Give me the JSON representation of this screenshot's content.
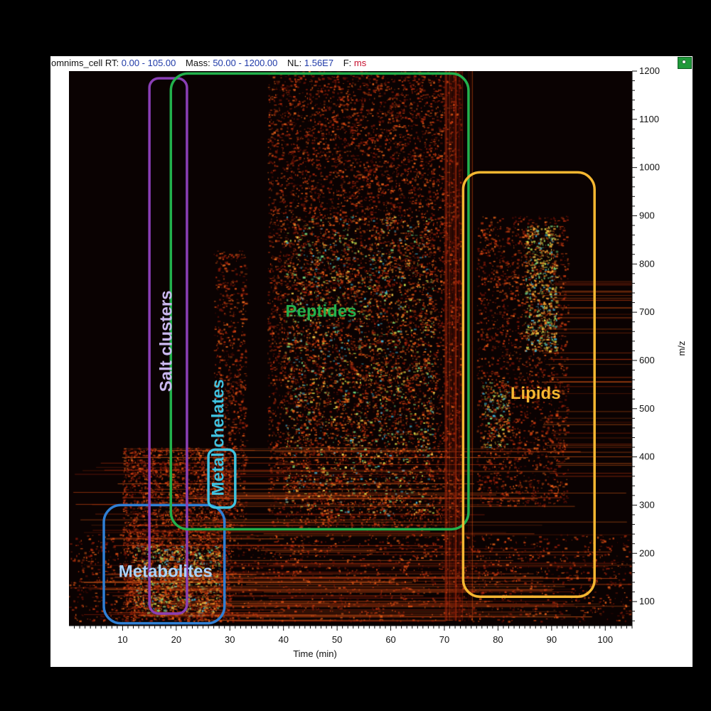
{
  "header": {
    "file_name": "omnims_cell",
    "rt_label": "RT:",
    "rt_range": "0.00 - 105.00",
    "mass_label": "Mass:",
    "mass_range": "50.00 - 1200.00",
    "nl_label": "NL:",
    "nl_value": "1.56E7",
    "f_label": "F:",
    "f_value": "ms"
  },
  "colors": {
    "header_value": "#1f3aa8",
    "header_filter": "#c8102e",
    "metabolites": "#2f7fd4",
    "salt_clusters": "#8a3fb6",
    "metal_chelates": "#3fc3e0",
    "peptides": "#22b14c",
    "lipids": "#f5b731"
  },
  "corner_icon": "settings-icon",
  "chart_data": {
    "type": "heatmap",
    "xlabel": "Time (min)",
    "ylabel": "m/z",
    "xlim": [
      0,
      105
    ],
    "ylim": [
      50,
      1200
    ],
    "x_ticks": [
      10,
      20,
      30,
      40,
      50,
      60,
      70,
      80,
      90,
      100
    ],
    "y_ticks": [
      100,
      200,
      300,
      400,
      500,
      600,
      700,
      800,
      900,
      1000,
      1100,
      1200
    ],
    "grid": false,
    "regions": [
      {
        "label": "Metabolites",
        "time_range": [
          6.5,
          29
        ],
        "mz_range": [
          55,
          300
        ],
        "color_key": "metabolites",
        "text_orientation": "horizontal"
      },
      {
        "label": "Salt clusters",
        "time_range": [
          15,
          22
        ],
        "mz_range": [
          75,
          1185
        ],
        "color_key": "salt_clusters",
        "text_orientation": "vertical"
      },
      {
        "label": "Metal chelates",
        "time_range": [
          26,
          31
        ],
        "mz_range": [
          295,
          415
        ],
        "color_key": "metal_chelates",
        "text_orientation": "vertical"
      },
      {
        "label": "Peptides",
        "time_range": [
          19,
          74.5
        ],
        "mz_range": [
          250,
          1195
        ],
        "color_key": "peptides",
        "text_orientation": "horizontal"
      },
      {
        "label": "Lipids",
        "time_range": [
          73.5,
          98
        ],
        "mz_range": [
          110,
          990
        ],
        "color_key": "lipids",
        "text_orientation": "horizontal"
      }
    ]
  }
}
